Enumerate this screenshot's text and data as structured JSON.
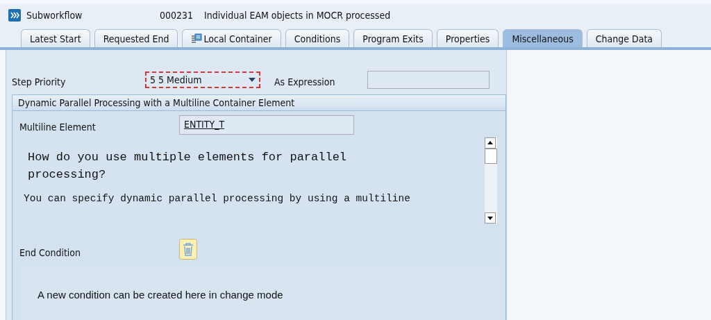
{
  "header": {
    "title": "Subworkflow",
    "number": "000231",
    "description": "Individual EAM objects in MOCR processed"
  },
  "tabs": [
    {
      "label": "Latest Start",
      "selected": false,
      "icon": false
    },
    {
      "label": "Requested End",
      "selected": false,
      "icon": false
    },
    {
      "label": "Local Container",
      "selected": false,
      "icon": true
    },
    {
      "label": "Conditions",
      "selected": false,
      "icon": false
    },
    {
      "label": "Program Exits",
      "selected": false,
      "icon": false
    },
    {
      "label": "Properties",
      "selected": false,
      "icon": false
    },
    {
      "label": "Miscellaneous",
      "selected": true,
      "icon": false
    },
    {
      "label": "Change Data",
      "selected": false,
      "icon": false
    }
  ],
  "step_priority": {
    "label": "Step Priority",
    "value": "5 5 Medium",
    "focused": true
  },
  "as_expression": {
    "label": "As Expression"
  },
  "group": {
    "title": "Dynamic Parallel Processing with a Multiline Container Element",
    "multiline_element": {
      "label": "Multiline Element",
      "value": "ENTITY_T"
    },
    "help_heading": "How do you use multiple elements for parallel processing?",
    "help_text": "You can specify dynamic parallel processing by using a multiline"
  },
  "end_condition": {
    "label": "End Condition",
    "message": "A new condition can be created here in change mode"
  }
}
